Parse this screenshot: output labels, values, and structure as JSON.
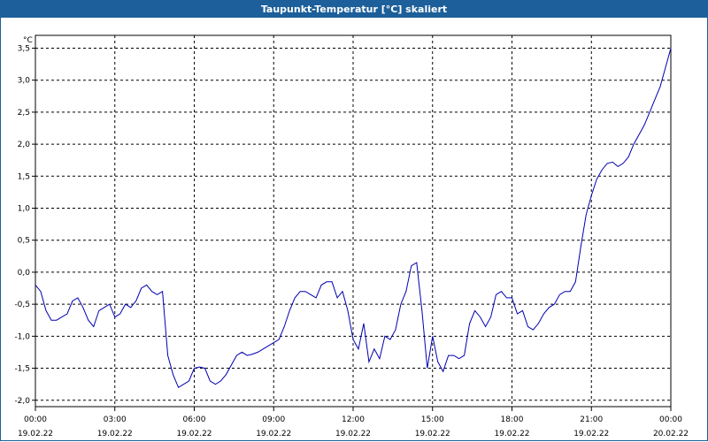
{
  "window": {
    "title": "Taupunkt-Temperatur [°C] skaliert"
  },
  "chart_data": {
    "type": "line",
    "title": "Taupunkt-Temperatur [°C] skaliert",
    "ylabel": "°C",
    "xlabel": "",
    "ylim": [
      -2.1,
      3.7
    ],
    "y_ticks": [
      "3,5",
      "3,0",
      "2,5",
      "2,0",
      "1,5",
      "1,0",
      "0,5",
      "0,0",
      "-0,5",
      "-1,0",
      "-1,5",
      "-2,0"
    ],
    "y_tick_values": [
      3.5,
      3.0,
      2.5,
      2.0,
      1.5,
      1.0,
      0.5,
      0.0,
      -0.5,
      -1.0,
      -1.5,
      -2.0
    ],
    "x_ticks": [
      {
        "time": "00:00",
        "date": "19.02.22"
      },
      {
        "time": "03:00",
        "date": "19.02.22"
      },
      {
        "time": "06:00",
        "date": "19.02.22"
      },
      {
        "time": "09:00",
        "date": "19.02.22"
      },
      {
        "time": "12:00",
        "date": "19.02.22"
      },
      {
        "time": "15:00",
        "date": "19.02.22"
      },
      {
        "time": "18:00",
        "date": "19.02.22"
      },
      {
        "time": "21:00",
        "date": "19.02.22"
      },
      {
        "time": "00:00",
        "date": "20.02.22"
      }
    ],
    "x_tick_hours": [
      0,
      3,
      6,
      9,
      12,
      15,
      18,
      21,
      24
    ],
    "grid": true,
    "line_color": "#0000b0",
    "series": [
      {
        "x": [
          0,
          0.2,
          0.4,
          0.6,
          0.8,
          1.0,
          1.2,
          1.4,
          1.6,
          1.8,
          2.0,
          2.2,
          2.4,
          2.6,
          2.8,
          3.0,
          3.2,
          3.4,
          3.6,
          3.8,
          4.0,
          4.2,
          4.4,
          4.6,
          4.8,
          5.0,
          5.2,
          5.4,
          5.6,
          5.8,
          6.0,
          6.2,
          6.4,
          6.6,
          6.8,
          7.0,
          7.2,
          7.4,
          7.6,
          7.8,
          8.0,
          8.2,
          8.4,
          8.6,
          8.8,
          9.0,
          9.2,
          9.4,
          9.6,
          9.8,
          10.0,
          10.2,
          10.4,
          10.6,
          10.8,
          11.0,
          11.2,
          11.4,
          11.6,
          11.8,
          12.0,
          12.2,
          12.4,
          12.6,
          12.8,
          13.0,
          13.2,
          13.4,
          13.6,
          13.8,
          14.0,
          14.2,
          14.4,
          14.6,
          14.8,
          15.0,
          15.2,
          15.4,
          15.6,
          15.8,
          16.0,
          16.2,
          16.4,
          16.6,
          16.8,
          17.0,
          17.2,
          17.4,
          17.6,
          17.8,
          18.0,
          18.2,
          18.4,
          18.6,
          18.8,
          19.0,
          19.2,
          19.4,
          19.6,
          19.8,
          20.0,
          20.2,
          20.4,
          20.6,
          20.8,
          21.0,
          21.2,
          21.4,
          21.6,
          21.8,
          22.0,
          22.2,
          22.4,
          22.6,
          22.8,
          23.0,
          23.2,
          23.4,
          23.6,
          23.8,
          24.0
        ],
        "values": [
          -0.2,
          -0.3,
          -0.6,
          -0.75,
          -0.75,
          -0.7,
          -0.65,
          -0.45,
          -0.4,
          -0.55,
          -0.75,
          -0.85,
          -0.6,
          -0.55,
          -0.5,
          -0.7,
          -0.65,
          -0.5,
          -0.55,
          -0.45,
          -0.25,
          -0.2,
          -0.3,
          -0.35,
          -0.3,
          -1.3,
          -1.6,
          -1.8,
          -1.75,
          -1.7,
          -1.5,
          -1.48,
          -1.5,
          -1.7,
          -1.75,
          -1.7,
          -1.6,
          -1.45,
          -1.3,
          -1.25,
          -1.3,
          -1.28,
          -1.25,
          -1.2,
          -1.15,
          -1.1,
          -1.05,
          -0.85,
          -0.6,
          -0.4,
          -0.3,
          -0.3,
          -0.35,
          -0.4,
          -0.2,
          -0.15,
          -0.15,
          -0.4,
          -0.3,
          -0.6,
          -1.05,
          -1.2,
          -0.8,
          -1.4,
          -1.2,
          -1.35,
          -1.0,
          -1.05,
          -0.9,
          -0.5,
          -0.3,
          0.1,
          0.15,
          -0.6,
          -1.5,
          -1.0,
          -1.4,
          -1.55,
          -1.3,
          -1.3,
          -1.35,
          -1.3,
          -0.8,
          -0.6,
          -0.7,
          -0.85,
          -0.7,
          -0.35,
          -0.3,
          -0.4,
          -0.4,
          -0.65,
          -0.6,
          -0.85,
          -0.9,
          -0.8,
          -0.65,
          -0.55,
          -0.5,
          -0.35,
          -0.3,
          -0.3,
          -0.15,
          0.4,
          0.9,
          1.2,
          1.45,
          1.6,
          1.7,
          1.72,
          1.65,
          1.7,
          1.8,
          2.0,
          2.15,
          2.3,
          2.5,
          2.7,
          2.9,
          3.2,
          3.5
        ]
      }
    ]
  }
}
